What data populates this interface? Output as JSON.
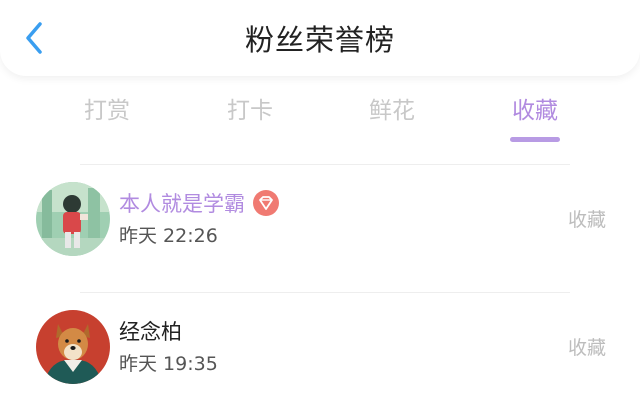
{
  "header": {
    "back_icon": "chevron-left-icon",
    "title": "粉丝荣誉榜"
  },
  "tabs": [
    {
      "label": "打赏",
      "active": false
    },
    {
      "label": "打卡",
      "active": false
    },
    {
      "label": "鲜花",
      "active": false
    },
    {
      "label": "收藏",
      "active": true
    }
  ],
  "list": [
    {
      "username": "本人就是学霸",
      "username_color": "#b18be0",
      "badge_icon": "diamond-badge-icon",
      "time": "昨天 22:26",
      "action": "收藏"
    },
    {
      "username": "经念柏",
      "username_color": "#222222",
      "time": "昨天 19:35",
      "action": "收藏"
    }
  ],
  "colors": {
    "accent": "#b18be0",
    "back_icon": "#3a9ef0",
    "inactive_tab": "#c8c8c8",
    "badge": "#f07a72"
  }
}
